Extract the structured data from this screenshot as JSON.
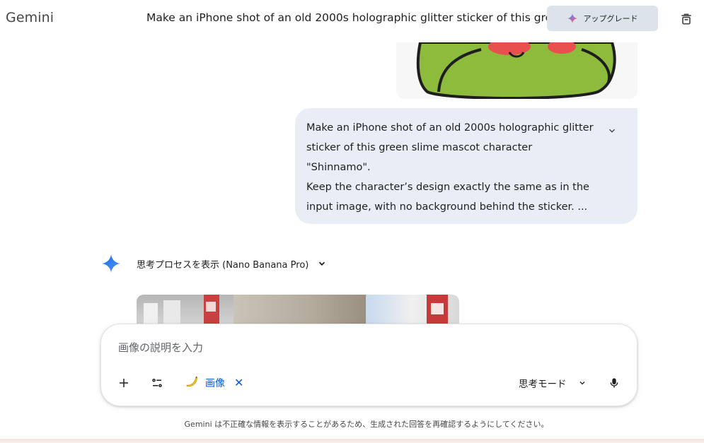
{
  "header": {
    "brand": "Gemini",
    "chat_title": "Make an iPhone shot of an old 2000s holographic glitter sticker of this gree",
    "upgrade_label": "アップグレード"
  },
  "user_message": {
    "lines": [
      "Make an iPhone shot of an old 2000s holographic glitter",
      "sticker of this green slime mascot character",
      "\"Shinnamo\".",
      "Keep the character’s design exactly the same as in the",
      "input image, with no background behind the sticker. ..."
    ]
  },
  "response": {
    "thinking_label": "思考プロセスを表示 (Nano Banana Pro)"
  },
  "composer": {
    "placeholder": "画像の説明を入力",
    "tool_chip_label": "画像",
    "mode_label": "思考モード"
  },
  "footer": {
    "disclaimer": "Gemini は不正確な情報を表示することがあるため、生成された回答を再確認するようにしてください。"
  },
  "colors": {
    "accent": "#0b57d0",
    "bubble": "#e9eef6",
    "upgrade_bg": "#dde3ea",
    "mascot_green": "#8dbb3c"
  },
  "icons": {
    "upgrade": "gemini-spark-icon",
    "delete": "trash-icon",
    "expand": "chevron-down-icon",
    "add": "plus-icon",
    "tools": "tune-icon",
    "chip": "banana-icon",
    "mic": "mic-icon"
  }
}
